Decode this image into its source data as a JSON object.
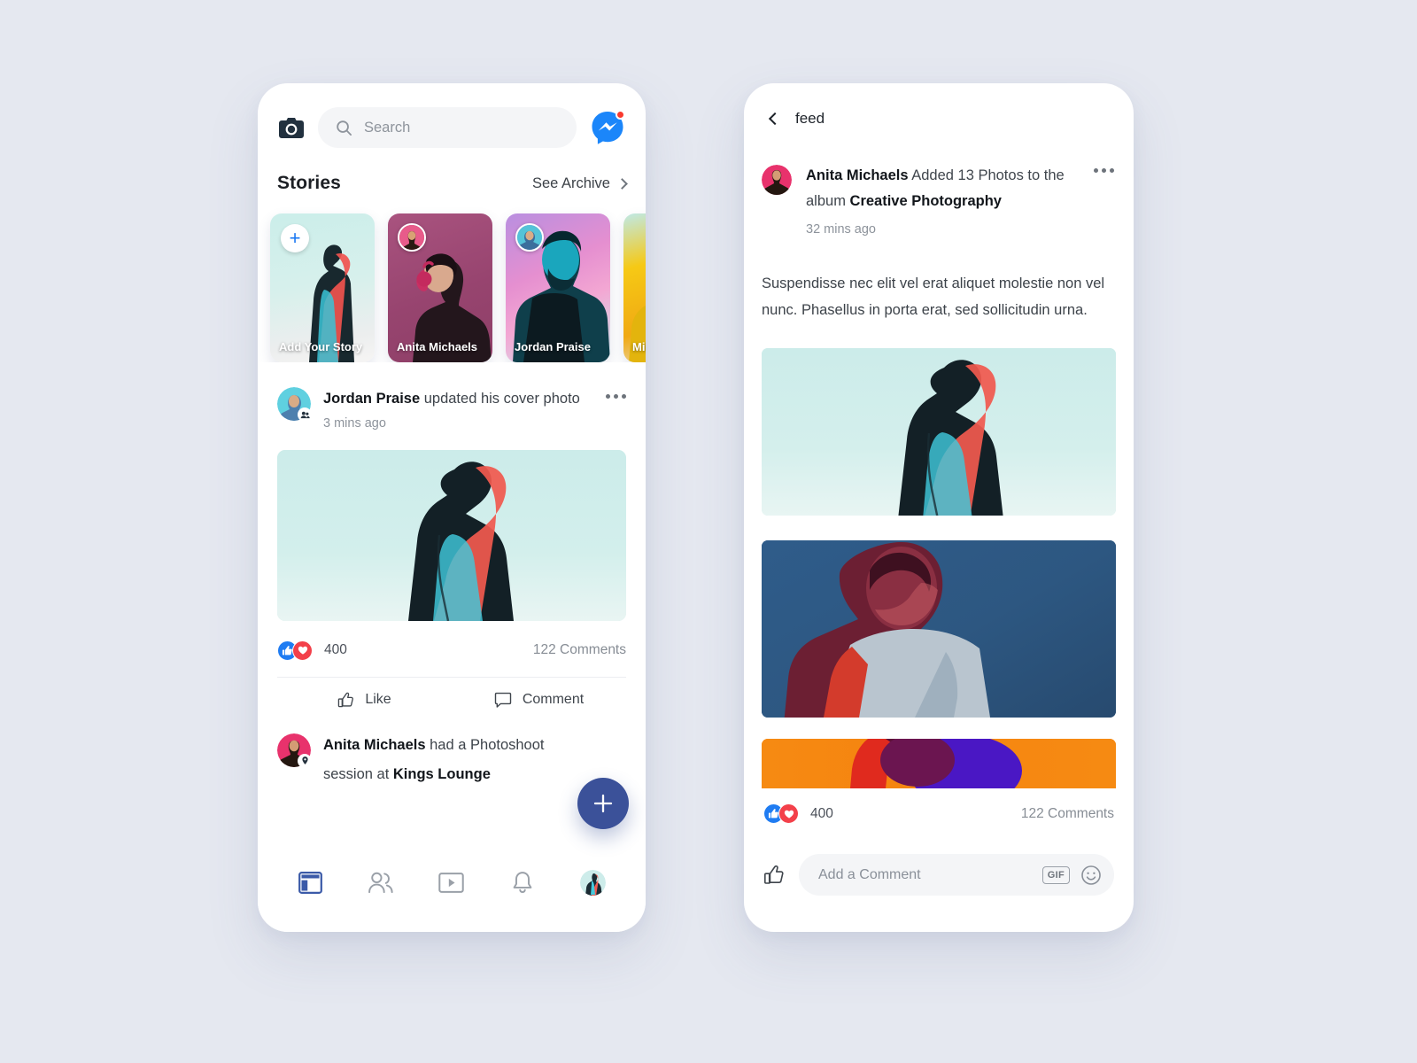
{
  "background_color": "#e5e8f0",
  "left_phone": {
    "topbar": {
      "camera_icon": "camera-icon",
      "search_placeholder": "Search",
      "search_value": "",
      "search_icon": "search-icon",
      "messenger_icon": "messenger-icon",
      "messenger_badge": true
    },
    "stories": {
      "title": "Stories",
      "see_archive_label": "See Archive",
      "chevron_icon": "chevron-right-icon",
      "items": [
        {
          "label": "Add Your Story",
          "type": "add",
          "plus_icon": "plus-icon",
          "bg": "#cdecea"
        },
        {
          "label": "Anita Michaels",
          "type": "story",
          "bg": "#9c4e76"
        },
        {
          "label": "Jordan Praise",
          "type": "story",
          "bg": "#d87ec6"
        },
        {
          "label": "Mike",
          "type": "story",
          "bg": "#f2c01b"
        }
      ]
    },
    "post": {
      "author": "Jordan Praise",
      "action_text": " updated his cover photo",
      "time": "3 mins ago",
      "more_icon": "more-options-icon",
      "reactions": {
        "like_icon": "thumbs-up-filled-icon",
        "love_icon": "heart-filled-icon",
        "count": "400"
      },
      "comments": "122 Comments",
      "actions": [
        {
          "label": "Like",
          "icon": "thumbs-up-outline-icon"
        },
        {
          "label": "Comment",
          "icon": "comment-bubble-icon"
        }
      ]
    },
    "post2": {
      "author": "Anita Michaels",
      "text_part1": " had a Photoshoot",
      "text_part2": "session at ",
      "place": "Kings Lounge"
    },
    "fab": {
      "icon": "plus-icon",
      "color": "#3b5199"
    },
    "tabbar": {
      "items": [
        {
          "name": "news-feed",
          "icon": "news-feed-icon",
          "active": true
        },
        {
          "name": "friends",
          "icon": "friends-icon",
          "active": false
        },
        {
          "name": "watch",
          "icon": "video-play-icon",
          "active": false
        },
        {
          "name": "notifications",
          "icon": "bell-icon",
          "active": false
        },
        {
          "name": "profile",
          "icon": "profile-avatar-icon",
          "active": false
        }
      ],
      "active_color": "#3b5aa8"
    }
  },
  "right_phone": {
    "header": {
      "back_icon": "chevron-left-icon",
      "title": "feed"
    },
    "post": {
      "author": "Anita Michaels",
      "action_mid": " Added 13 Photos to the",
      "action_line2_pre": "album ",
      "album": "Creative Photography",
      "time": "32 mins ago",
      "more_icon": "more-options-icon",
      "body": "Suspendisse nec elit vel erat aliquet molestie non vel nunc. Phasellus in porta erat, sed sollicitudin urna.",
      "photos": [
        {
          "name": "photo-teal-portrait",
          "bg": "#cdeeea"
        },
        {
          "name": "photo-blue-portrait",
          "bg": "#2f5a85"
        },
        {
          "name": "photo-orange-portrait",
          "bg": "#f68712"
        }
      ],
      "reactions": {
        "like_icon": "thumbs-up-filled-icon",
        "love_icon": "heart-filled-icon",
        "count": "400"
      },
      "comments": "122 Comments"
    },
    "composer": {
      "like_icon": "thumbs-up-outline-icon",
      "placeholder": "Add a Comment",
      "value": "",
      "gif_label": "GIF",
      "emoji_icon": "smiley-face-icon"
    }
  }
}
